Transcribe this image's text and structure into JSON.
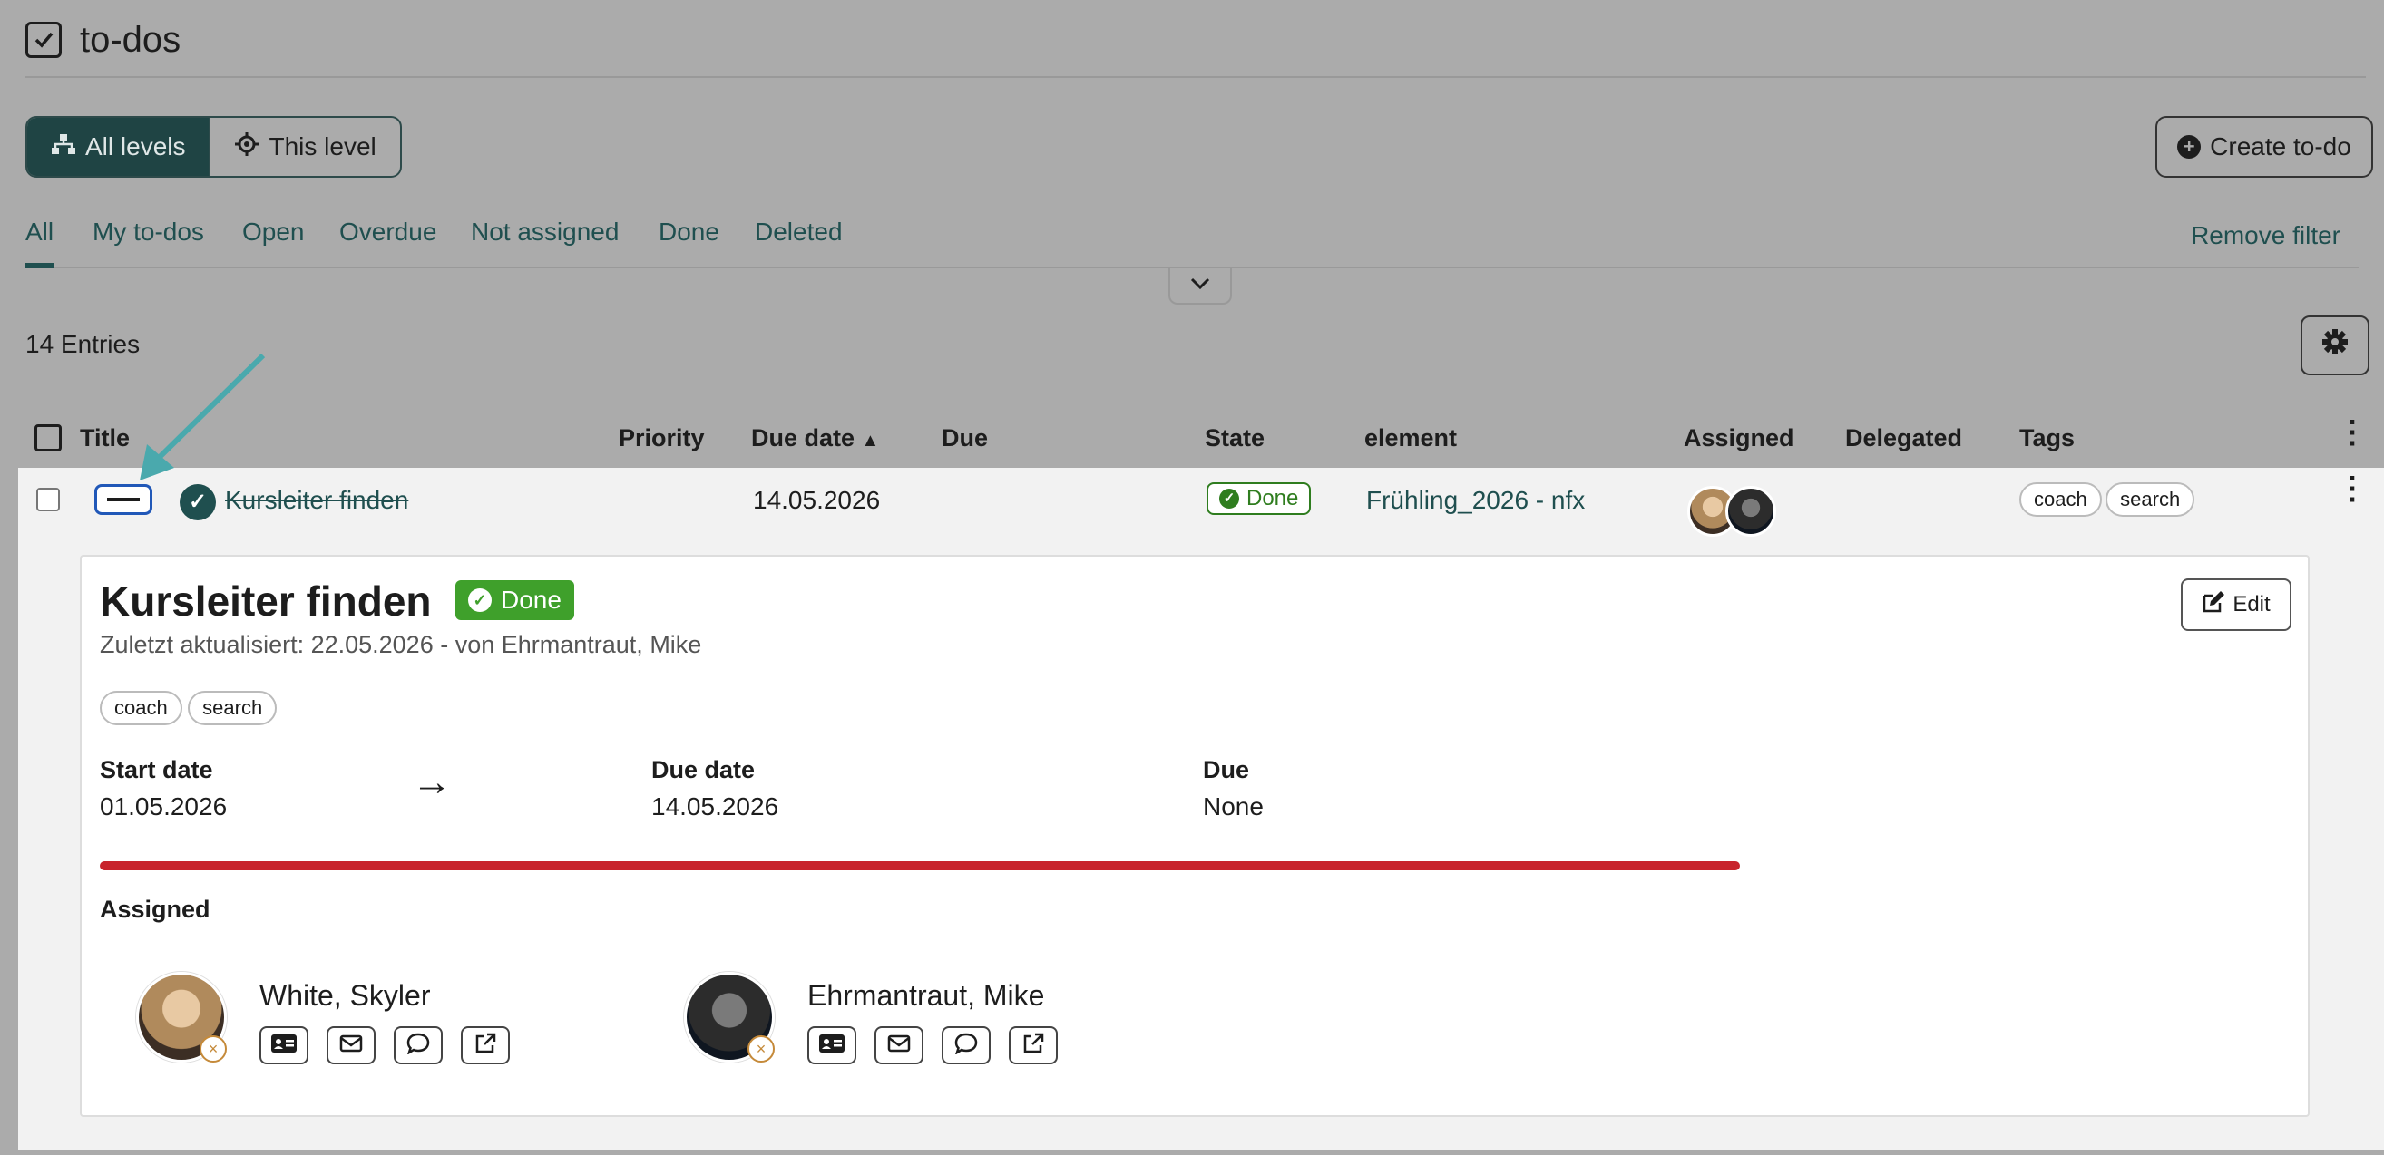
{
  "header": {
    "title": "to-dos",
    "icon": "checkbox-icon"
  },
  "level_toggle": {
    "all_levels": "All levels",
    "this_level": "This level"
  },
  "create_button": "Create to-do",
  "filter_tabs": [
    "All",
    "My to-dos",
    "Open",
    "Overdue",
    "Not assigned",
    "Done",
    "Deleted"
  ],
  "active_tab": "All",
  "remove_filter": "Remove filter",
  "entries": "14 Entries",
  "columns": [
    "Title",
    "Priority",
    "Due date",
    "Due",
    "State",
    "element",
    "Assigned",
    "Delegated",
    "Tags"
  ],
  "row": {
    "title": "Kursleiter finden",
    "priority": "",
    "due_date": "14.05.2026",
    "due": "",
    "state": "Done",
    "element": "Frühling_2026 - nfx",
    "tags": [
      "coach",
      "search"
    ]
  },
  "detail": {
    "title": "Kursleiter finden",
    "state": "Done",
    "subtitle": "Zuletzt aktualisiert: 22.05.2026 - von Ehrmantraut, Mike",
    "edit_label": "Edit",
    "tags": [
      "coach",
      "search"
    ],
    "start_date_label": "Start date",
    "start_date": "01.05.2026",
    "due_date_label": "Due date",
    "due_date": "14.05.2026",
    "due_label": "Due",
    "due": "None",
    "progress": 1.0,
    "progress_color": "#c8232c",
    "assigned_label": "Assigned",
    "assignees": [
      {
        "name": "White, Skyler"
      },
      {
        "name": "Ehrmantraut, Mike"
      }
    ]
  },
  "colors": {
    "accent": "#1f4f4f",
    "done_green": "#3fa02b",
    "focus_blue": "#2158b8"
  }
}
